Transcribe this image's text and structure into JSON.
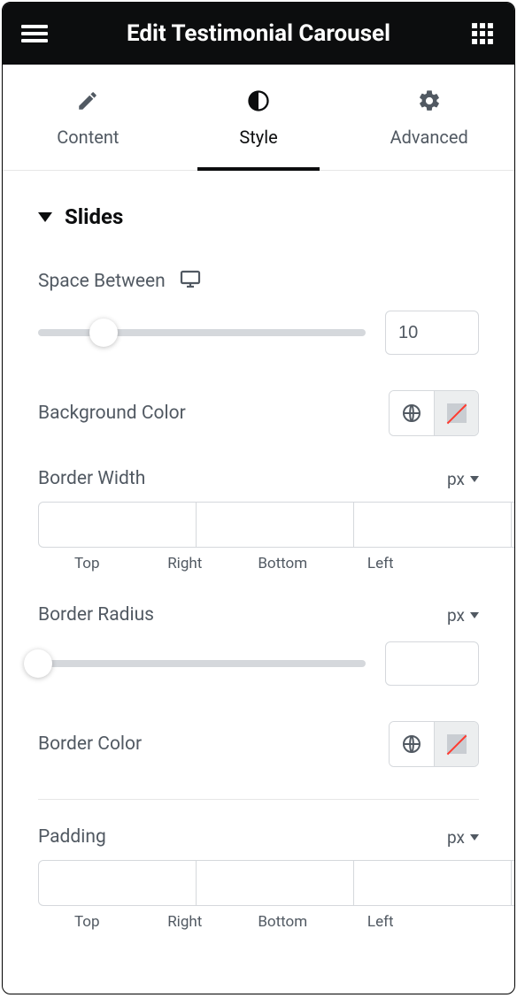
{
  "header": {
    "title": "Edit Testimonial Carousel"
  },
  "tabs": {
    "content": "Content",
    "style": "Style",
    "advanced": "Advanced"
  },
  "section": {
    "title": "Slides"
  },
  "space_between": {
    "label": "Space Between",
    "value": "10"
  },
  "background_color": {
    "label": "Background Color"
  },
  "border_width": {
    "label": "Border Width",
    "unit": "px",
    "sides": {
      "top": "Top",
      "right": "Right",
      "bottom": "Bottom",
      "left": "Left"
    }
  },
  "border_radius": {
    "label": "Border Radius",
    "unit": "px",
    "value": ""
  },
  "border_color": {
    "label": "Border Color"
  },
  "padding": {
    "label": "Padding",
    "unit": "px",
    "sides": {
      "top": "Top",
      "right": "Right",
      "bottom": "Bottom",
      "left": "Left"
    }
  }
}
